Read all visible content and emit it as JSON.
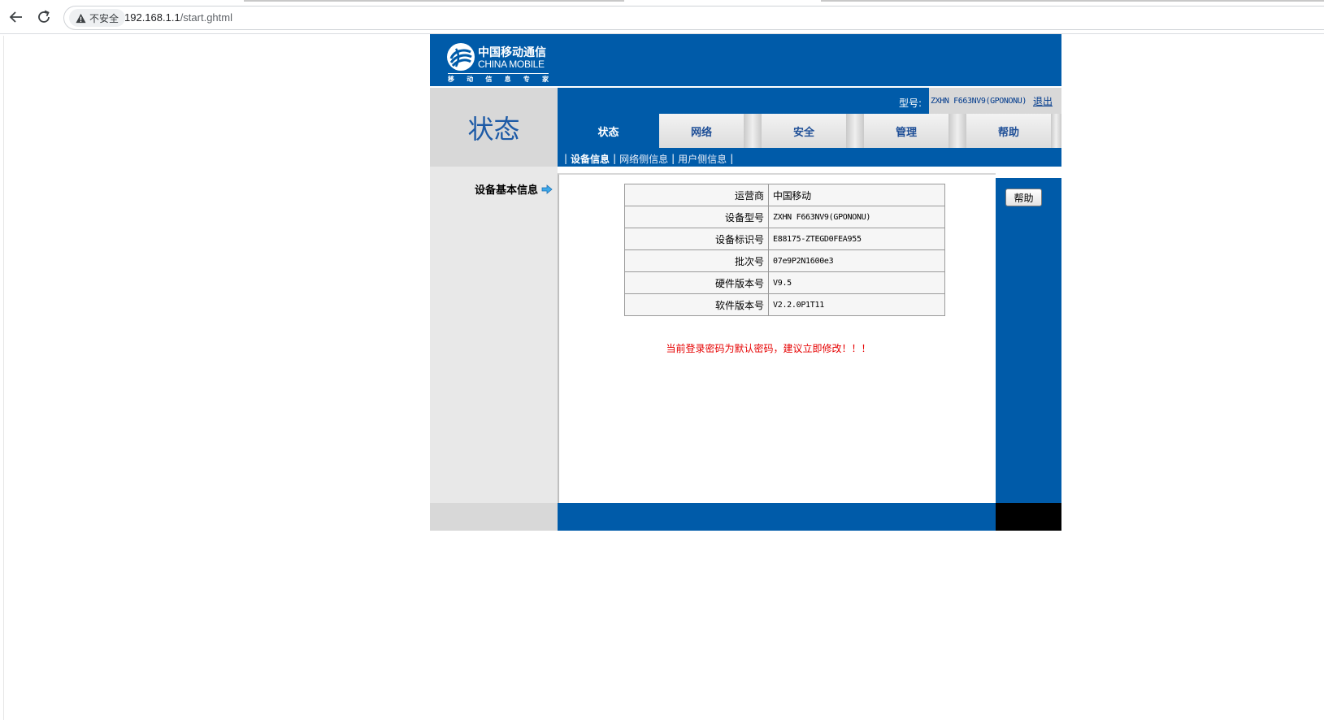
{
  "browser": {
    "security_label": "不安全",
    "url_host": "192.168.1.1",
    "url_path": "/start.ghtml"
  },
  "brand": {
    "name_cn": "中国移动通信",
    "name_en": "CHINA MOBILE",
    "slogan": [
      "移",
      "动",
      "信",
      "息",
      "专",
      "家"
    ],
    "color_primary": "#005ba9"
  },
  "header": {
    "section_title": "状态",
    "model_label": "型号:",
    "model_value": "ZXHN F663NV9(GPONONU)",
    "logout": "退出"
  },
  "tabs": [
    {
      "label": "状态",
      "active": true
    },
    {
      "label": "网络",
      "active": false
    },
    {
      "label": "安全",
      "active": false
    },
    {
      "label": "管理",
      "active": false
    },
    {
      "label": "帮助",
      "active": false
    }
  ],
  "subnav": [
    {
      "label": "设备信息",
      "active": true
    },
    {
      "label": "网络侧信息",
      "active": false
    },
    {
      "label": "用户侧信息",
      "active": false
    }
  ],
  "sidebar": {
    "heading": "设备基本信息"
  },
  "device_info": [
    {
      "key": "运营商",
      "value": "中国移动"
    },
    {
      "key": "设备型号",
      "value": "ZXHN F663NV9(GPONONU)"
    },
    {
      "key": "设备标识号",
      "value": "E88175-ZTEGD0FEA955"
    },
    {
      "key": "批次号",
      "value": "07e9P2N1600e3"
    },
    {
      "key": "硬件版本号",
      "value": "V9.5"
    },
    {
      "key": "软件版本号",
      "value": "V2.2.0P1T11"
    }
  ],
  "warning": "当前登录密码为默认密码，建议立即修改！！！",
  "help_button": "帮助"
}
